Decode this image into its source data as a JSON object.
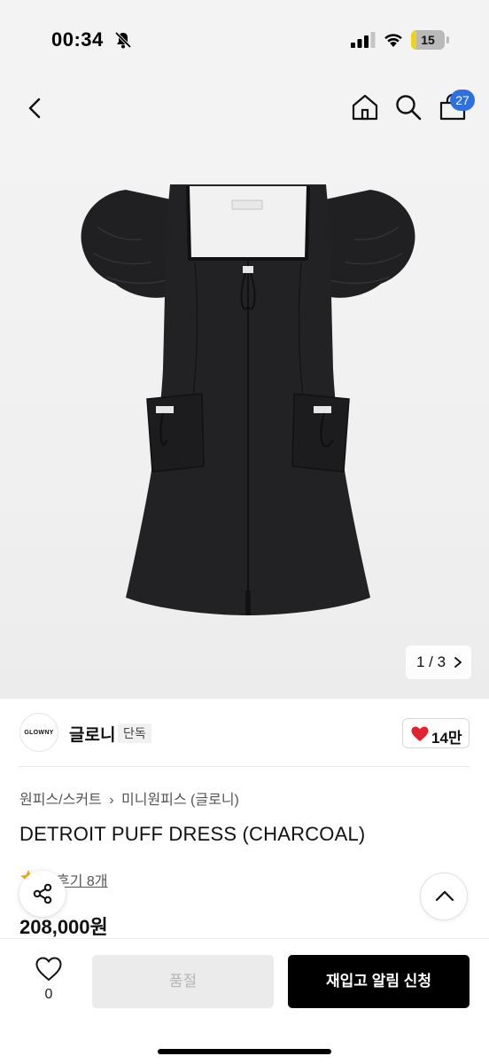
{
  "status_bar": {
    "time": "00:34",
    "battery_level": "15",
    "battery_fraction": 0.15,
    "battery_color": "#f1d21b",
    "icons": [
      "bell-muted-icon",
      "signal-icon",
      "wifi-icon",
      "battery-icon"
    ]
  },
  "header": {
    "icons": [
      "back-icon",
      "home-icon",
      "search-icon",
      "cart-icon"
    ],
    "cart_count": "27",
    "badge_color": "#2f6fe0"
  },
  "gallery": {
    "page_indicator": "1 / 3"
  },
  "brand": {
    "logo_text": "GLOWNY",
    "name": "글로니",
    "tag": "단독",
    "like_count": "14만",
    "like_color": "#e0242f"
  },
  "product": {
    "breadcrumb": [
      "원피스/스커트",
      "미니원피스 (글로니)"
    ],
    "title": "DETROIT PUFF DRESS (CHARCOAL)",
    "reviews": "후기 8개",
    "price": "208,000원"
  },
  "bottom_bar": {
    "wishlist_count": "0",
    "size_button": "품절",
    "restock_button": "재입고 알림 신청"
  }
}
